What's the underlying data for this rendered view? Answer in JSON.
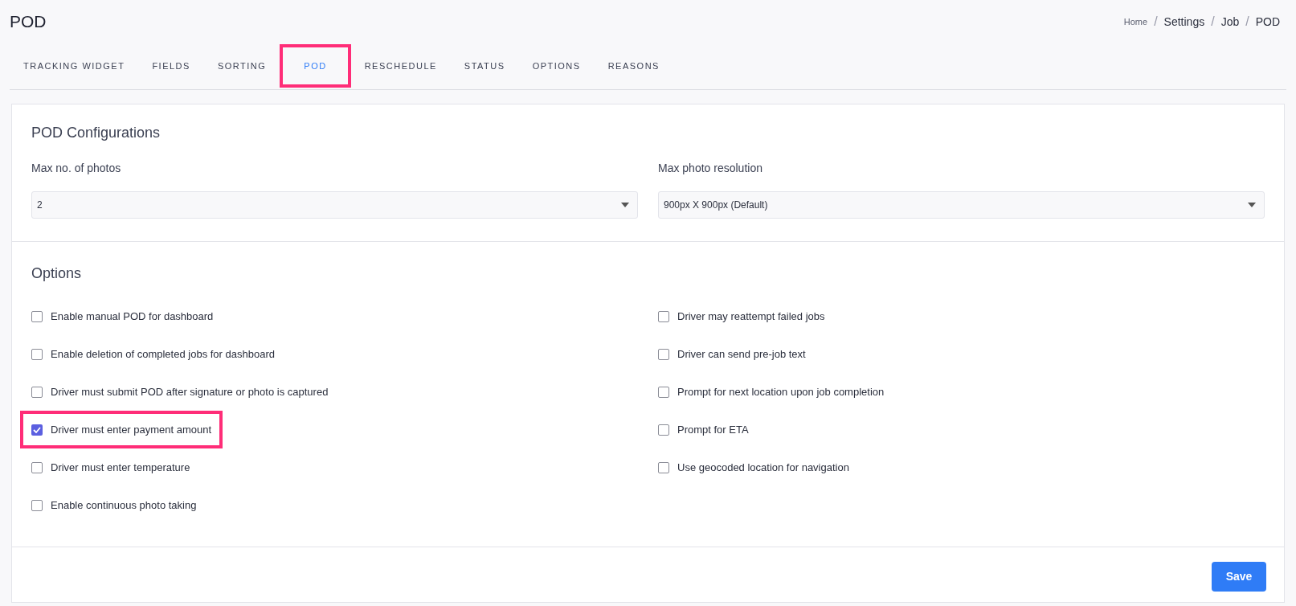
{
  "page_title": "POD",
  "breadcrumb": [
    {
      "label": "Home",
      "current": false
    },
    {
      "label": "Settings",
      "current": true
    },
    {
      "label": "Job",
      "current": true
    },
    {
      "label": "POD",
      "current": true
    }
  ],
  "breadcrumb_separators": [
    "/",
    "/",
    "/"
  ],
  "tabs": [
    {
      "label": "TRACKING WIDGET",
      "selected": false,
      "highlighted": false
    },
    {
      "label": "FIELDS",
      "selected": false,
      "highlighted": false
    },
    {
      "label": "SORTING",
      "selected": false,
      "highlighted": false
    },
    {
      "label": "POD",
      "selected": true,
      "highlighted": true
    },
    {
      "label": "RESCHEDULE",
      "selected": false,
      "highlighted": false
    },
    {
      "label": "STATUS",
      "selected": false,
      "highlighted": false
    },
    {
      "label": "OPTIONS",
      "selected": false,
      "highlighted": false
    },
    {
      "label": "REASONS",
      "selected": false,
      "highlighted": false
    }
  ],
  "pod_configurations": {
    "heading": "POD Configurations",
    "fields": [
      {
        "label": "Max no. of photos",
        "value": "2"
      },
      {
        "label": "Max photo resolution",
        "value": "900px X 900px (Default)"
      }
    ]
  },
  "options": {
    "heading": "Options",
    "left": [
      {
        "label": "Enable manual POD for dashboard",
        "checked": false,
        "highlighted": false
      },
      {
        "label": "Enable deletion of completed jobs for dashboard",
        "checked": false,
        "highlighted": false
      },
      {
        "label": "Driver must submit POD after signature or photo is captured",
        "checked": false,
        "highlighted": false
      },
      {
        "label": "Driver must enter payment amount",
        "checked": true,
        "highlighted": true
      },
      {
        "label": "Driver must enter temperature",
        "checked": false,
        "highlighted": false
      },
      {
        "label": "Enable continuous photo taking",
        "checked": false,
        "highlighted": false
      }
    ],
    "right": [
      {
        "label": "Driver may reattempt failed jobs",
        "checked": false,
        "highlighted": false
      },
      {
        "label": "Driver can send pre-job text",
        "checked": false,
        "highlighted": false
      },
      {
        "label": "Prompt for next location upon job completion",
        "checked": false,
        "highlighted": false
      },
      {
        "label": "Prompt for ETA",
        "checked": false,
        "highlighted": false
      },
      {
        "label": "Use geocoded location for navigation",
        "checked": false,
        "highlighted": false
      }
    ]
  },
  "save_button": "Save"
}
